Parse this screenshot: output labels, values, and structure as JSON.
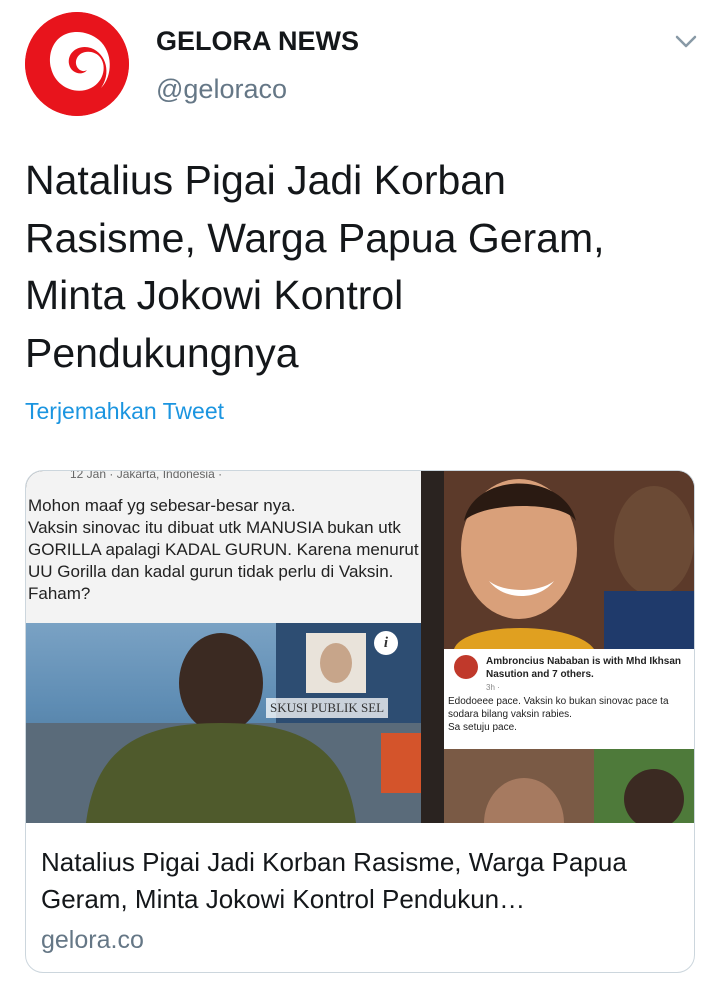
{
  "author": {
    "name": "GELORA NEWS",
    "handle": "@geloraco",
    "avatar_icon": "gelora-logo-icon",
    "brand_color": "#e8141c"
  },
  "menu": {
    "icon": "chevron-down-icon"
  },
  "tweet": {
    "text": "Natalius Pigai Jadi Korban Rasisme, Warga Papua Geram, Minta Jokowi Kontrol Pendukungnya",
    "translate_label": "Terjemahkan Tweet"
  },
  "card": {
    "image": {
      "location_line": "12 Jan · Jakarta, Indonesia ·",
      "post_text": "Mohon maaf yg sebesar-besar nya.\nVaksin sinovac itu dibuat utk MANUSIA bukan utk GORILLA apalagi KADAL GURUN. Karena menurut UU Gorilla dan kadal gurun tidak perlu di Vaksin. Faham?",
      "banner_text": "SKUSI PUBLIK SEL",
      "info_icon": "i",
      "fb_post": {
        "name": "Ambroncius Nababan is with Mhd Ikhsan Nasution and 7 others.",
        "time": "3h ·",
        "comment": "Edodoeee pace. Vaksin ko bukan sinovac pace ta\nsodara bilang vaksin rabies.\nSa setuju pace."
      }
    },
    "title": "Natalius Pigai Jadi Korban Rasisme, Warga Papua Geram, Minta Jokowi Kontrol Pendukun…",
    "domain": "gelora.co"
  }
}
